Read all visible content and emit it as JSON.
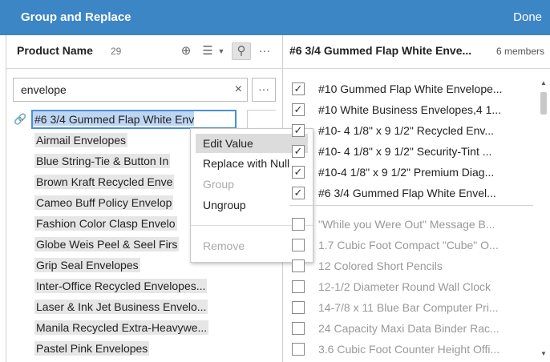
{
  "titlebar": {
    "title": "Group and Replace",
    "done_label": "Done"
  },
  "left_panel": {
    "field_name": "Product Name",
    "count": "29",
    "search": {
      "value": "envelope",
      "clear": "×"
    },
    "more": "···",
    "editing_value": "#6 3/4 Gummed Flap White Env",
    "items": [
      "Airmail Envelopes",
      "Blue String-Tie & Button In",
      "Brown Kraft Recycled Enve",
      "Cameo Buff Policy Envelop",
      "Fashion Color Clasp Envelo",
      "Globe Weis Peel & Seel Firs",
      "Grip Seal Envelopes",
      "Inter-Office Recycled Envelopes...",
      "Laser & Ink Jet Business Envelo...",
      "Manila Recycled Extra-Heavywe...",
      "Pastel Pink Envelopes"
    ]
  },
  "context_menu": {
    "edit_value": "Edit Value",
    "replace_null": "Replace with Null",
    "group": "Group",
    "ungroup": "Ungroup",
    "remove": "Remove"
  },
  "right_panel": {
    "title": "#6 3/4 Gummed Flap White Enve...",
    "members": "6 members",
    "checked_items": [
      "#10 Gummed Flap White Envelope...",
      "#10 White Business Envelopes,4 1...",
      "#10- 4 1/8\" x 9 1/2\" Recycled Env...",
      "#10- 4 1/8\" x 9 1/2\" Security-Tint ...",
      "#10-4 1/8\" x 9 1/2\" Premium Diag...",
      "#6 3/4 Gummed Flap White Envel..."
    ],
    "unchecked_items": [
      "\"While you Were Out\" Message B...",
      "1.7 Cubic Foot Compact \"Cube\" O...",
      "12 Colored Short Pencils",
      "12-1/2 Diameter Round Wall Clock",
      "14-7/8 x 11 Blue Bar Computer Pri...",
      "24 Capacity Maxi Data Binder Rac...",
      "3.6 Cubic Foot Counter Height Offi..."
    ],
    "check_mark": "✓"
  }
}
